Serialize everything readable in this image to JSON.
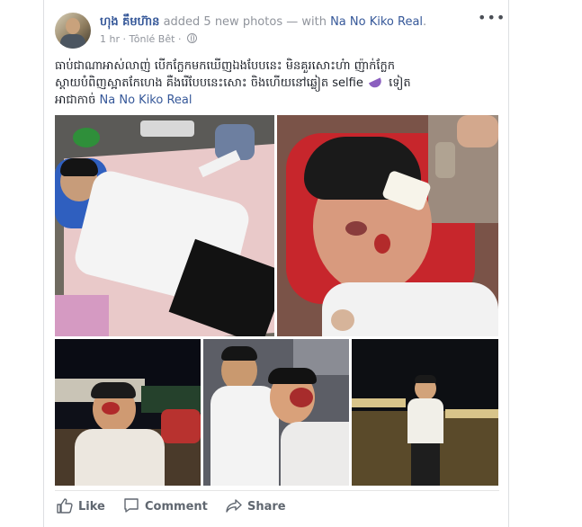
{
  "post": {
    "author": "ហុង គឹមហ៊ាន",
    "action_text": "added 5 new photos — with",
    "tagged_name": "Na No Kiko Real",
    "tagged_suffix": ".",
    "time": "1 hr",
    "location_separator": "·",
    "location": "Tônlé Bêt",
    "privacy_separator": "·",
    "more_glyph": "•••",
    "body_line1": "ធាប់ជាណាអាស់លាញ់ បើកក្លែកមកឃើញឯងបែបនេះ មិនគួរសោះហ៎ា ញ៉ាក់ក្លែក",
    "body_line2_start": "ស្ដាយបំពិញស្អាតកែហេង គឺងរើបែបនេះសោះ ចិងហើយនៅឆ្លៀត selfie",
    "body_line2_end": "ទៀត",
    "body_line3_start": "អាជាកាច់",
    "body_mention": "Na No Kiko Real"
  },
  "photos": [
    {
      "alt": "photo-1"
    },
    {
      "alt": "photo-2"
    },
    {
      "alt": "photo-3"
    },
    {
      "alt": "photo-4"
    },
    {
      "alt": "photo-5"
    }
  ],
  "actions": {
    "like": "Like",
    "comment": "Comment",
    "share": "Share"
  },
  "colors": {
    "link": "#365899",
    "muted": "#90949c",
    "action": "#606770",
    "border": "#dddfe2"
  }
}
